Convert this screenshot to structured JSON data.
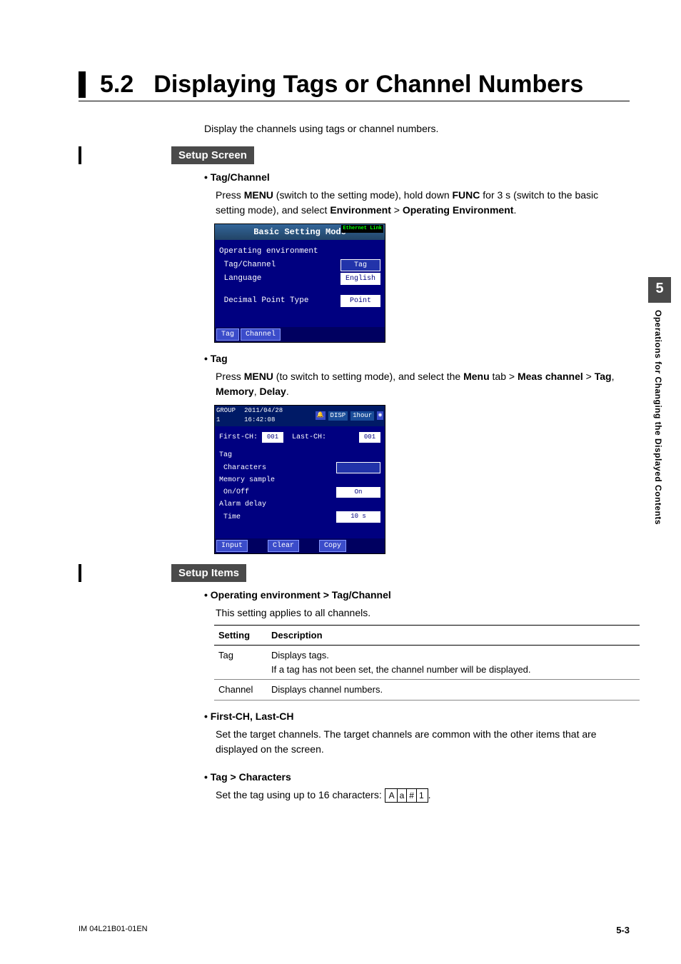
{
  "chapter_number": "5",
  "side_tab_text": "Operations for Changing the Displayed Contents",
  "heading": {
    "number": "5.2",
    "title": "Displaying Tags or Channel Numbers"
  },
  "intro": "Display the channels using tags or channel numbers.",
  "setup_screen_label": "Setup Screen",
  "tagchannel": {
    "title": "Tag/Channel",
    "text_pre": "Press ",
    "key1": "MENU",
    "text_mid1": " (switch to the setting mode), hold down ",
    "key2": "FUNC",
    "text_mid2": " for 3 s (switch to the basic setting mode), and select ",
    "key3": "Environment",
    "gt": " > ",
    "key4": "Operating Environment",
    "text_end": "."
  },
  "ss1": {
    "title": "Basic Setting Mode",
    "badge": "Ethernet Link",
    "rows": [
      {
        "label": "Operating environment",
        "value": ""
      },
      {
        "label": " Tag/Channel",
        "value": "Tag",
        "hl": true
      },
      {
        "label": " Language",
        "value": "English"
      },
      {
        "label": "",
        "value": ""
      },
      {
        "label": " Decimal Point Type",
        "value": "Point"
      }
    ],
    "footer_buttons": [
      "Tag",
      "Channel"
    ]
  },
  "tag": {
    "title": "Tag",
    "text_pre": "Press ",
    "key1": "MENU",
    "text_mid1": " (to switch to setting mode), and select the ",
    "key2": "Menu",
    "text_mid2": " tab > ",
    "key3": "Meas channel",
    "gt": " > ",
    "key4": "Tag",
    "sep": ", ",
    "key5": "Memory",
    "key6": "Delay",
    "text_end": "."
  },
  "ss2": {
    "header_group": "GROUP 1",
    "header_time": "2011/04/28 16:42:08",
    "header_disp": "DISP",
    "header_span": "1hour",
    "rows_top": {
      "first_label": "First-CH:",
      "first_value": "001",
      "last_label": "Last-CH:",
      "last_value": "001"
    },
    "rows": [
      {
        "label": "Tag",
        "sub": " Characters",
        "value": "",
        "hl": true
      },
      {
        "label": "Memory sample",
        "sub": " On/Off",
        "value": "On"
      },
      {
        "label": "Alarm delay",
        "sub": " Time",
        "value": "10 s"
      }
    ],
    "footer_buttons": [
      "Input",
      "Clear",
      "Copy"
    ]
  },
  "setup_items_label": "Setup Items",
  "op_env": {
    "title": "Operating environment > Tag/Channel",
    "desc": "This setting applies to all channels."
  },
  "table": {
    "headers": [
      "Setting",
      "Description"
    ],
    "rows": [
      {
        "setting": "Tag",
        "desc1": "Displays tags.",
        "desc2": "If a tag has not been set, the channel number will be displayed."
      },
      {
        "setting": "Channel",
        "desc1": "Displays channel numbers.",
        "desc2": ""
      }
    ]
  },
  "firstlast": {
    "title": "First-CH, Last-CH",
    "desc": "Set the target channels. The target channels are common with the other items that are displayed on the screen."
  },
  "tagchars": {
    "title": "Tag > Characters",
    "desc_pre": "Set the tag using up to 16 characters: ",
    "chars": [
      "A",
      "a",
      "#",
      "1"
    ],
    "desc_post": "."
  },
  "footer": {
    "left": "IM 04L21B01-01EN",
    "right": "5-3"
  }
}
